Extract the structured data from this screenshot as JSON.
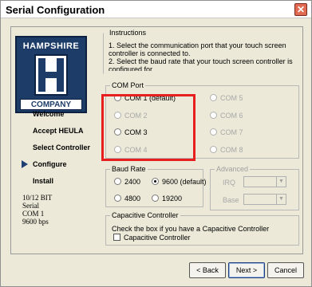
{
  "window": {
    "title": "Serial Configuration",
    "close_glyph": "✕"
  },
  "logo": {
    "top": "HAMPSHIRE",
    "bottom": "COMPANY"
  },
  "nav": {
    "items": [
      "Welcome",
      "Accept HEULA",
      "Select Controller",
      "Configure",
      "Install"
    ],
    "current": "Configure"
  },
  "info": {
    "lines": [
      "10/12 BIT",
      "Serial",
      "COM 1",
      "9600 bps"
    ]
  },
  "instructions": {
    "legend": "Instructions",
    "line1": "1. Select the communication port that your touch screen",
    "line2": "controller is connected to.",
    "line3": "2. Select the baud rate that your touch screen controller is",
    "line4": "configured for."
  },
  "com_port": {
    "legend": "COM Port",
    "options": [
      {
        "label": "COM 1 (default)",
        "enabled": true,
        "selected": false
      },
      {
        "label": "COM 2",
        "enabled": false,
        "selected": false
      },
      {
        "label": "COM 3",
        "enabled": true,
        "selected": false
      },
      {
        "label": "COM 4",
        "enabled": false,
        "selected": false
      },
      {
        "label": "COM 5",
        "enabled": false,
        "selected": false
      },
      {
        "label": "COM 6",
        "enabled": false,
        "selected": false
      },
      {
        "label": "COM 7",
        "enabled": false,
        "selected": false
      },
      {
        "label": "COM 8",
        "enabled": false,
        "selected": false
      }
    ]
  },
  "baud_rate": {
    "legend": "Baud Rate",
    "options": [
      {
        "label": "2400",
        "selected": false
      },
      {
        "label": "9600 (default)",
        "selected": true
      },
      {
        "label": "4800",
        "selected": false
      },
      {
        "label": "19200",
        "selected": false
      }
    ]
  },
  "advanced": {
    "legend": "Advanced",
    "irq_label": "IRQ",
    "base_label": "Base"
  },
  "capacitive": {
    "legend": "Capacitive Controller",
    "text": "Check the box if you have a Capacitive Controller",
    "checkbox_label": "Capacitive Controller",
    "checked": false
  },
  "buttons": {
    "back": "< Back",
    "next": "Next >",
    "cancel": "Cancel"
  },
  "colors": {
    "highlight": "#e81f1f",
    "logo_navy": "#1d3d68",
    "dialog_bg": "#ece9d8"
  }
}
